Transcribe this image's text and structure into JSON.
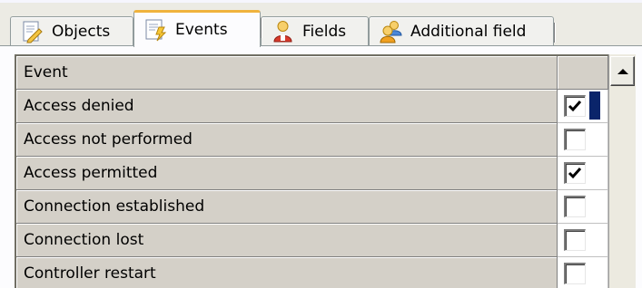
{
  "tabs": [
    {
      "label": "Objects",
      "icon": "objects-icon",
      "active": false
    },
    {
      "label": "Events",
      "icon": "events-icon",
      "active": true
    },
    {
      "label": "Fields",
      "icon": "fields-icon",
      "active": false
    },
    {
      "label": "Additional field",
      "icon": "additional-field-icon",
      "active": false
    }
  ],
  "grid": {
    "header": {
      "label": "Event"
    },
    "rows": [
      {
        "label": "Access denied",
        "checked": true,
        "focused": true
      },
      {
        "label": "Access not performed",
        "checked": false,
        "focused": false
      },
      {
        "label": "Access permitted",
        "checked": true,
        "focused": false
      },
      {
        "label": "Connection established",
        "checked": false,
        "focused": false
      },
      {
        "label": "Connection lost",
        "checked": false,
        "focused": false
      },
      {
        "label": "Controller restart",
        "checked": false,
        "focused": false
      }
    ]
  },
  "colors": {
    "tab_active_accent": "#f0b33d",
    "focus_marker": "#0a246a",
    "grid_cell": "#d4d0c8"
  }
}
